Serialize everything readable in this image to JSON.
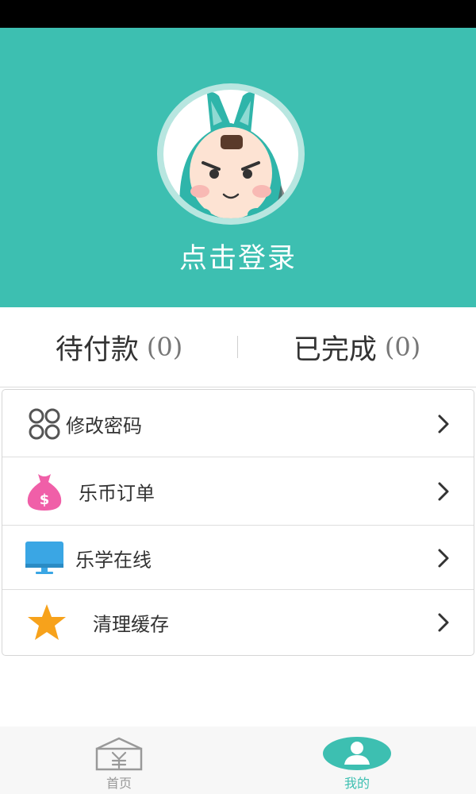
{
  "header": {
    "login_label": "点击登录"
  },
  "orders": {
    "pending": {
      "label": "待付款",
      "count": "(0)"
    },
    "completed": {
      "label": "已完成",
      "count": "(0)"
    }
  },
  "menu": {
    "items": [
      {
        "label": "修改密码",
        "icon": "four-circles-icon"
      },
      {
        "label": "乐币订单",
        "icon": "money-bag-icon"
      },
      {
        "label": "乐学在线",
        "icon": "monitor-icon"
      },
      {
        "label": "清理缓存",
        "icon": "star-icon"
      }
    ]
  },
  "tabbar": {
    "tabs": [
      {
        "label": "首页",
        "icon": "home-yen-icon",
        "active": false
      },
      {
        "label": "我的",
        "icon": "user-icon",
        "active": true
      }
    ]
  },
  "colors": {
    "header_bg": "#3dbfb1",
    "active_tab": "#3dbfb1",
    "inactive_tab": "#999999",
    "money_bag": "#f05fa8",
    "monitor": "#3aa6e4",
    "star": "#f7a21b"
  }
}
